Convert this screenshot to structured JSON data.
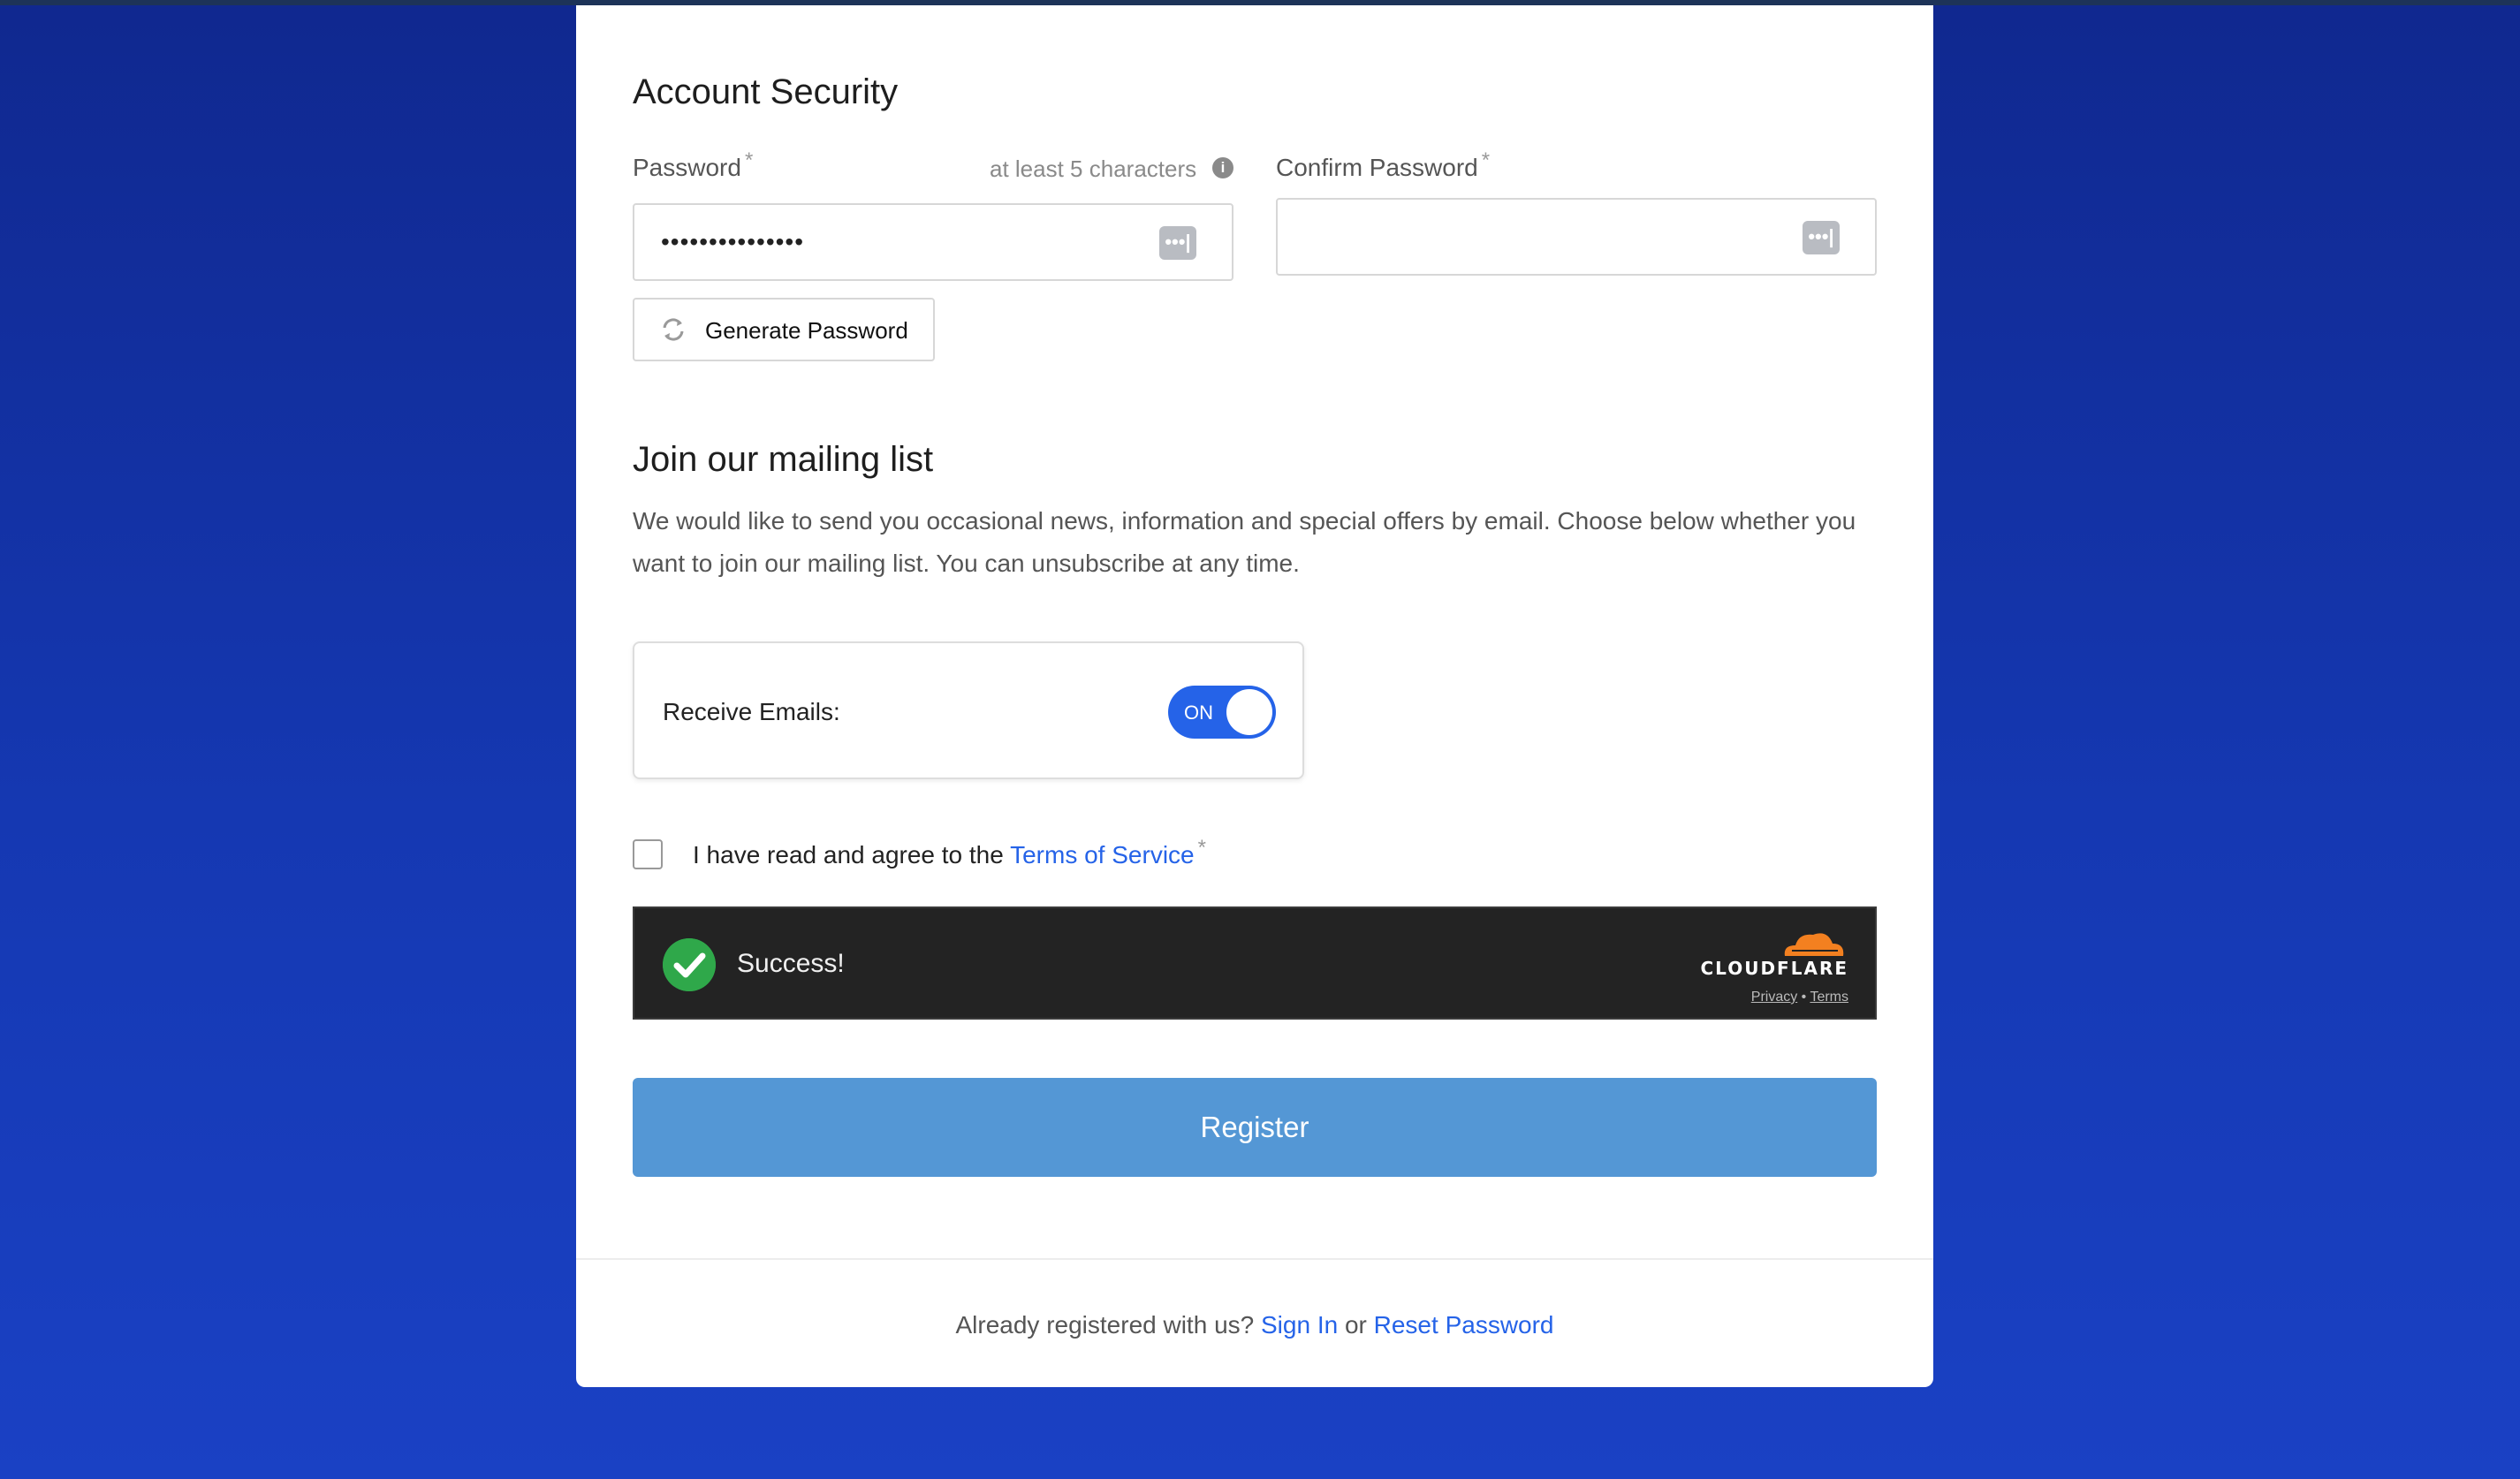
{
  "account_security": {
    "heading": "Account Security",
    "password": {
      "label": "Password",
      "required_mark": "*",
      "hint": "at least 5 characters",
      "value": "•••••••••••••••"
    },
    "confirm_password": {
      "label": "Confirm Password",
      "required_mark": "*",
      "value": ""
    },
    "generate_button": "Generate Password"
  },
  "mailing_list": {
    "heading": "Join our mailing list",
    "description": "We would like to send you occasional news, information and special offers by email. Choose below whether you want to join our mailing list. You can unsubscribe at any time.",
    "receive_emails_label": "Receive Emails:",
    "toggle_state": "ON"
  },
  "terms": {
    "prefix": "I have read and agree to the",
    "link": "Terms of Service",
    "required_mark": "*"
  },
  "captcha": {
    "status": "Success!",
    "brand": "CLOUDFLARE",
    "privacy": "Privacy",
    "separator": "•",
    "terms": "Terms"
  },
  "register_button": "Register",
  "footer": {
    "text": "Already registered with us?",
    "sign_in": "Sign In",
    "or": "or",
    "reset": "Reset Password"
  },
  "colors": {
    "accent": "#2563e8",
    "register": "#5497d5",
    "success": "#2fa84a",
    "cloudflare_orange": "#f38020"
  },
  "icons": [
    "info-icon",
    "password-manager-icon",
    "refresh-icon",
    "checkmark-icon",
    "cloudflare-logo"
  ]
}
